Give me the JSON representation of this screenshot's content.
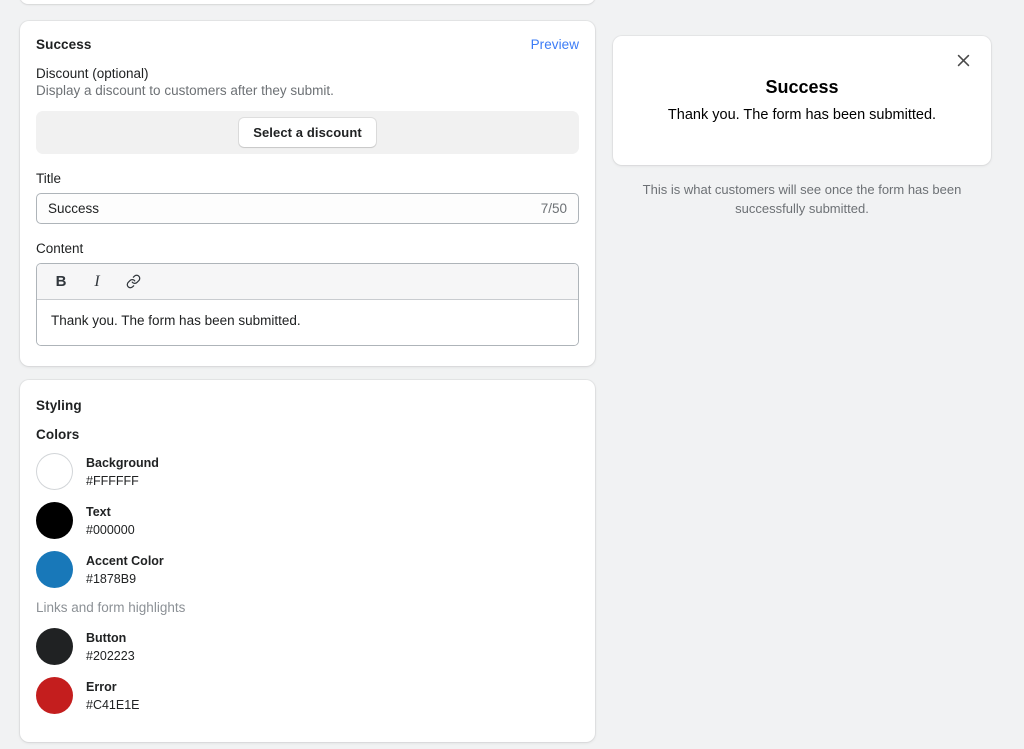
{
  "success_card": {
    "title": "Success",
    "preview_link": "Preview",
    "discount": {
      "label": "Discount (optional)",
      "help": "Display a discount to customers after they submit.",
      "button_label": "Select a discount"
    },
    "title_field": {
      "label": "Title",
      "value": "Success",
      "char_count": "7/50"
    },
    "content_field": {
      "label": "Content",
      "toolbar": [
        {
          "name": "bold-icon",
          "glyph": "B"
        },
        {
          "name": "italic-icon",
          "glyph": "I"
        },
        {
          "name": "link-icon",
          "glyph": "🔗"
        }
      ],
      "value": "Thank you. The form has been submitted."
    }
  },
  "styling_card": {
    "heading": "Styling",
    "colors_heading": "Colors",
    "colors": [
      {
        "name": "Background",
        "hex": "#FFFFFF",
        "note": null
      },
      {
        "name": "Text",
        "hex": "#000000",
        "note": null
      },
      {
        "name": "Accent Color",
        "hex": "#1878B9",
        "note": "Links and form highlights"
      },
      {
        "name": "Button",
        "hex": "#202223",
        "note": null
      },
      {
        "name": "Error",
        "hex": "#C41E1E",
        "note": null
      }
    ]
  },
  "preview_panel": {
    "title": "Success",
    "body": "Thank you. The form has been submitted.",
    "close_icon": "close-icon",
    "caption": "This is what customers will see once the form has been successfully submitted."
  }
}
